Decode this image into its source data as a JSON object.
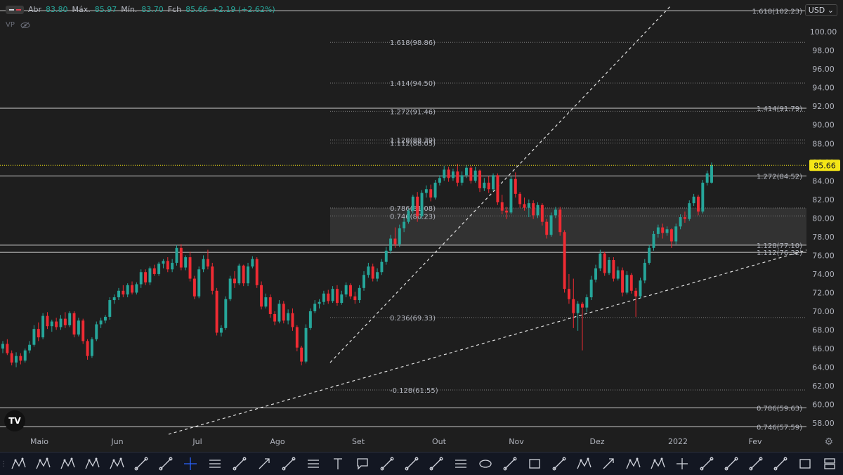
{
  "legend": {
    "open_key": "Abr",
    "open": "83.80",
    "high_key": "Máx.",
    "high": "85.97",
    "low_key": "Mín.",
    "low": "83.70",
    "close_key": "Fch",
    "close": "85.66",
    "change": "+2.19 (+2.62%)",
    "vp_label": "VP"
  },
  "currency": "USD",
  "logo_text": "TV",
  "colors": {
    "up": "#26a69a",
    "down": "#ef2b33",
    "background": "#1e1e1e",
    "price_tag": "#f5e616"
  },
  "chart_data": {
    "type": "candlestick",
    "y_range": [
      56.5,
      102.8
    ],
    "y_ticks": [
      58,
      60,
      62,
      64,
      66,
      68,
      70,
      72,
      74,
      76,
      78,
      80,
      82,
      84,
      86,
      88,
      90,
      92,
      94,
      96,
      98,
      100
    ],
    "x_range": [
      0,
      1150
    ],
    "x_labels": [
      {
        "label": "Maio",
        "x": 56
      },
      {
        "label": "Jun",
        "x": 167
      },
      {
        "label": "Jul",
        "x": 281
      },
      {
        "label": "Ago",
        "x": 395
      },
      {
        "label": "Set",
        "x": 510
      },
      {
        "label": "Out",
        "x": 625
      },
      {
        "label": "Nov",
        "x": 735
      },
      {
        "label": "Dez",
        "x": 850
      },
      {
        "label": "2022",
        "x": 965
      },
      {
        "label": "Fev",
        "x": 1075
      }
    ],
    "last_price": "85.66",
    "candles_ohlc": [
      [
        66.0,
        66.8,
        65.5,
        66.5
      ],
      [
        66.5,
        67.0,
        65.3,
        65.5
      ],
      [
        65.5,
        65.8,
        64.2,
        64.5
      ],
      [
        64.5,
        65.6,
        64.0,
        65.2
      ],
      [
        65.2,
        65.5,
        64.3,
        64.7
      ],
      [
        64.7,
        66.0,
        64.5,
        65.8
      ],
      [
        65.8,
        66.8,
        65.5,
        66.4
      ],
      [
        66.4,
        68.5,
        66.2,
        68.1
      ],
      [
        68.1,
        68.8,
        66.8,
        67.2
      ],
      [
        67.2,
        69.8,
        67.0,
        69.5
      ],
      [
        69.5,
        69.9,
        68.1,
        68.4
      ],
      [
        68.4,
        69.1,
        67.8,
        68.9
      ],
      [
        68.9,
        69.3,
        68.0,
        68.3
      ],
      [
        68.3,
        69.6,
        68.0,
        69.2
      ],
      [
        69.2,
        69.9,
        68.2,
        68.5
      ],
      [
        68.5,
        70.0,
        68.3,
        69.8
      ],
      [
        69.8,
        70.0,
        67.2,
        67.5
      ],
      [
        67.5,
        69.3,
        67.3,
        69.0
      ],
      [
        69.0,
        69.2,
        66.5,
        66.8
      ],
      [
        66.8,
        67.0,
        64.8,
        65.2
      ],
      [
        65.2,
        67.2,
        65.0,
        67.0
      ],
      [
        67.0,
        68.9,
        66.8,
        68.6
      ],
      [
        68.6,
        69.3,
        68.2,
        69.0
      ],
      [
        69.0,
        69.6,
        68.7,
        69.4
      ],
      [
        69.4,
        71.5,
        69.1,
        71.2
      ],
      [
        71.2,
        71.8,
        70.8,
        71.5
      ],
      [
        71.5,
        72.5,
        71.2,
        72.2
      ],
      [
        72.2,
        72.8,
        71.5,
        71.8
      ],
      [
        71.8,
        73.0,
        71.5,
        72.8
      ],
      [
        72.8,
        73.2,
        71.8,
        72.0
      ],
      [
        72.0,
        73.1,
        71.8,
        72.9
      ],
      [
        72.9,
        74.5,
        72.5,
        74.2
      ],
      [
        74.2,
        74.5,
        72.8,
        73.1
      ],
      [
        73.1,
        74.8,
        72.8,
        74.6
      ],
      [
        74.6,
        75.0,
        73.8,
        74.0
      ],
      [
        74.0,
        75.3,
        73.8,
        75.1
      ],
      [
        75.1,
        75.6,
        74.6,
        75.4
      ],
      [
        75.4,
        75.8,
        74.2,
        74.5
      ],
      [
        74.5,
        75.6,
        74.2,
        75.2
      ],
      [
        75.2,
        77.1,
        74.9,
        76.8
      ],
      [
        76.8,
        77.2,
        74.4,
        74.7
      ],
      [
        74.7,
        76.0,
        74.4,
        75.8
      ],
      [
        75.8,
        76.4,
        73.2,
        73.5
      ],
      [
        73.5,
        73.8,
        71.3,
        71.6
      ],
      [
        71.6,
        74.8,
        71.4,
        74.5
      ],
      [
        74.5,
        76.0,
        74.2,
        75.6
      ],
      [
        75.6,
        76.6,
        74.5,
        74.8
      ],
      [
        74.8,
        75.2,
        71.8,
        72.2
      ],
      [
        72.2,
        72.5,
        67.4,
        67.7
      ],
      [
        67.7,
        68.5,
        67.3,
        68.2
      ],
      [
        68.2,
        71.6,
        68.0,
        71.3
      ],
      [
        71.3,
        73.8,
        71.1,
        73.5
      ],
      [
        73.5,
        74.3,
        72.5,
        73.0
      ],
      [
        73.0,
        75.1,
        72.8,
        74.9
      ],
      [
        74.9,
        75.0,
        72.7,
        73.0
      ],
      [
        73.0,
        75.2,
        72.7,
        74.8
      ],
      [
        74.8,
        75.9,
        74.6,
        75.6
      ],
      [
        75.6,
        75.8,
        72.5,
        72.8
      ],
      [
        72.8,
        73.2,
        70.2,
        70.5
      ],
      [
        70.5,
        71.9,
        70.3,
        71.5
      ],
      [
        71.5,
        71.8,
        69.3,
        69.7
      ],
      [
        69.7,
        70.0,
        68.5,
        68.9
      ],
      [
        68.9,
        71.2,
        68.7,
        70.8
      ],
      [
        70.8,
        71.1,
        68.7,
        69.0
      ],
      [
        69.0,
        70.2,
        68.6,
        69.8
      ],
      [
        69.8,
        70.3,
        67.9,
        68.3
      ],
      [
        68.3,
        68.5,
        65.7,
        66.1
      ],
      [
        66.1,
        66.3,
        64.2,
        64.6
      ],
      [
        64.6,
        68.6,
        64.4,
        68.2
      ],
      [
        68.2,
        70.3,
        68.0,
        70.0
      ],
      [
        70.0,
        71.2,
        69.8,
        70.8
      ],
      [
        70.8,
        71.3,
        70.3,
        71.0
      ],
      [
        71.0,
        72.2,
        70.7,
        71.9
      ],
      [
        71.9,
        72.3,
        70.8,
        71.1
      ],
      [
        71.1,
        72.7,
        70.9,
        72.4
      ],
      [
        72.4,
        72.8,
        70.6,
        70.9
      ],
      [
        70.9,
        72.2,
        70.7,
        71.8
      ],
      [
        71.8,
        73.1,
        71.5,
        72.8
      ],
      [
        72.8,
        73.0,
        71.3,
        71.6
      ],
      [
        71.6,
        72.1,
        70.8,
        71.2
      ],
      [
        71.2,
        72.8,
        70.9,
        72.5
      ],
      [
        72.5,
        74.3,
        72.2,
        73.9
      ],
      [
        73.9,
        75.2,
        73.6,
        74.8
      ],
      [
        74.8,
        75.1,
        73.2,
        73.5
      ],
      [
        73.5,
        74.6,
        73.2,
        74.2
      ],
      [
        74.2,
        75.6,
        73.9,
        75.3
      ],
      [
        75.3,
        76.9,
        75.0,
        76.5
      ],
      [
        76.5,
        78.2,
        76.2,
        77.8
      ],
      [
        77.8,
        79.0,
        76.8,
        77.2
      ],
      [
        77.2,
        79.3,
        76.9,
        78.9
      ],
      [
        78.9,
        80.0,
        78.5,
        79.6
      ],
      [
        79.6,
        81.0,
        79.4,
        80.8
      ],
      [
        80.8,
        82.5,
        80.5,
        82.3
      ],
      [
        82.3,
        82.8,
        79.6,
        80.2
      ],
      [
        80.2,
        83.0,
        79.9,
        82.7
      ],
      [
        82.7,
        83.5,
        82.2,
        83.1
      ],
      [
        83.1,
        83.6,
        81.8,
        82.2
      ],
      [
        82.2,
        84.1,
        82.0,
        83.8
      ],
      [
        83.8,
        84.6,
        83.5,
        84.3
      ],
      [
        84.3,
        85.6,
        84.0,
        85.2
      ],
      [
        85.2,
        85.5,
        83.9,
        84.3
      ],
      [
        84.3,
        85.3,
        84.0,
        85.0
      ],
      [
        85.0,
        85.8,
        83.4,
        83.8
      ],
      [
        83.8,
        85.0,
        83.5,
        84.6
      ],
      [
        84.6,
        85.7,
        84.3,
        85.4
      ],
      [
        85.4,
        85.6,
        83.7,
        84.0
      ],
      [
        84.0,
        85.5,
        83.8,
        85.1
      ],
      [
        85.1,
        85.2,
        82.8,
        83.2
      ],
      [
        83.2,
        84.3,
        82.9,
        83.8
      ],
      [
        83.8,
        84.5,
        82.7,
        83.1
      ],
      [
        83.1,
        84.8,
        82.9,
        84.6
      ],
      [
        84.6,
        84.8,
        81.4,
        81.7
      ],
      [
        81.7,
        82.5,
        80.4,
        80.8
      ],
      [
        80.8,
        81.2,
        79.9,
        80.6
      ],
      [
        80.6,
        84.5,
        80.4,
        84.2
      ],
      [
        84.2,
        84.9,
        82.2,
        82.6
      ],
      [
        82.6,
        82.8,
        81.1,
        81.5
      ],
      [
        81.5,
        82.2,
        80.8,
        81.1
      ],
      [
        81.1,
        82.0,
        80.1,
        81.6
      ],
      [
        81.6,
        81.9,
        79.9,
        80.3
      ],
      [
        80.3,
        81.7,
        80.0,
        81.4
      ],
      [
        81.4,
        81.6,
        79.2,
        79.6
      ],
      [
        79.6,
        79.9,
        77.8,
        78.2
      ],
      [
        78.2,
        80.6,
        78.0,
        80.3
      ],
      [
        80.3,
        81.2,
        80.0,
        80.9
      ],
      [
        80.9,
        81.2,
        78.1,
        78.5
      ],
      [
        78.5,
        78.7,
        72.0,
        72.4
      ],
      [
        72.4,
        74.0,
        70.8,
        71.3
      ],
      [
        71.3,
        73.5,
        68.2,
        69.8
      ],
      [
        69.8,
        71.1,
        67.9,
        70.8
      ],
      [
        70.8,
        71.0,
        65.8,
        70.4
      ],
      [
        70.4,
        71.8,
        69.9,
        71.5
      ],
      [
        71.5,
        73.8,
        71.2,
        73.4
      ],
      [
        73.4,
        75.0,
        73.1,
        74.6
      ],
      [
        74.6,
        76.6,
        74.3,
        76.2
      ],
      [
        76.2,
        76.4,
        73.8,
        74.1
      ],
      [
        74.1,
        75.8,
        73.9,
        75.5
      ],
      [
        75.5,
        75.8,
        73.2,
        73.5
      ],
      [
        73.5,
        74.8,
        73.3,
        74.4
      ],
      [
        74.4,
        74.7,
        71.6,
        72.0
      ],
      [
        72.0,
        74.3,
        71.8,
        73.9
      ],
      [
        73.9,
        74.1,
        71.9,
        72.2
      ],
      [
        72.2,
        72.5,
        69.4,
        71.6
      ],
      [
        71.6,
        73.6,
        71.4,
        73.3
      ],
      [
        73.3,
        75.6,
        73.0,
        75.2
      ],
      [
        75.2,
        77.1,
        75.0,
        76.8
      ],
      [
        76.8,
        78.6,
        76.5,
        78.3
      ],
      [
        78.3,
        79.3,
        77.9,
        79.0
      ],
      [
        79.0,
        79.4,
        77.8,
        78.4
      ],
      [
        78.4,
        79.1,
        78.1,
        78.8
      ],
      [
        78.8,
        78.9,
        76.8,
        77.5
      ],
      [
        77.5,
        79.4,
        77.2,
        79.1
      ],
      [
        79.1,
        80.4,
        78.8,
        80.1
      ],
      [
        80.1,
        80.7,
        79.5,
        79.9
      ],
      [
        79.9,
        81.9,
        79.7,
        81.6
      ],
      [
        81.6,
        82.6,
        81.3,
        82.3
      ],
      [
        82.3,
        82.5,
        80.3,
        80.7
      ],
      [
        80.7,
        84.1,
        80.5,
        83.8
      ],
      [
        83.8,
        85.1,
        83.5,
        84.8
      ],
      [
        83.8,
        85.97,
        83.7,
        85.66
      ]
    ],
    "trendlines": [
      {
        "from": [
          470,
          64.5
        ],
        "to": [
          955,
          102.8
        ],
        "style": "dashed"
      },
      {
        "from": [
          240,
          56.8
        ],
        "to": [
          1200,
          77.7
        ],
        "style": "dashed"
      }
    ],
    "horizontal_lines": [
      102.23,
      91.79,
      84.52,
      77.1,
      76.32,
      59.63,
      57.59
    ],
    "fib_levels": [
      {
        "label": "1.618(98.86)",
        "value": 98.86
      },
      {
        "label": "1.414(94.50)",
        "value": 94.5
      },
      {
        "label": "1.272(91.46)",
        "value": 91.46
      },
      {
        "label": "1.128(88.39)",
        "value": 88.39
      },
      {
        "label": "1.112(88.05)",
        "value": 88.05
      },
      {
        "label": "0.786(81.08)",
        "value": 81.08
      },
      {
        "label": "0.746(80.23)",
        "value": 80.23
      },
      {
        "label": "0.236(69.33)",
        "value": 69.33
      },
      {
        "label": "-0.128(61.55)",
        "value": 61.55
      }
    ],
    "right_labels": [
      {
        "label": "1.618(102.23)",
        "value": 102.23
      },
      {
        "label": "1.414(91.79)",
        "value": 91.79
      },
      {
        "label": "1.272(84.52)",
        "value": 84.52
      },
      {
        "label": "1.128(77.10)",
        "value": 77.1
      },
      {
        "label": "1.112(76.32)",
        "value": 76.32
      },
      {
        "label": "0.786(59.63)",
        "value": 59.63
      },
      {
        "label": "0.746(57.59)",
        "value": 57.59
      }
    ],
    "zone": {
      "from": 77.1,
      "to": 81.08
    }
  },
  "toolbar": {
    "tools": [
      "xabcd-pattern-icon",
      "abcd-pattern-icon",
      "abc-pattern-icon",
      "head-shoulders-icon",
      "triangle-pattern-icon",
      "fan-icon",
      "gann-icon",
      "crosshair-icon",
      "parallel-channel-icon",
      "trend-line-icon",
      "arrow-icon",
      "pitchfork-icon",
      "regression-icon",
      "text-icon",
      "callout-icon",
      "path-icon",
      "price-label-icon",
      "network-icon",
      "fib-levels-icon",
      "ellipse-icon",
      "measure-icon",
      "rectangle-icon",
      "polyline-icon",
      "wxy-pattern-icon",
      "ray-icon",
      "wxyz-pattern-icon",
      "ae-pattern-icon",
      "cross-line-icon",
      "brush-icon",
      "wave-icon",
      "curve-icon",
      "pencil-icon",
      "frame-icon",
      "long-position-icon"
    ]
  }
}
